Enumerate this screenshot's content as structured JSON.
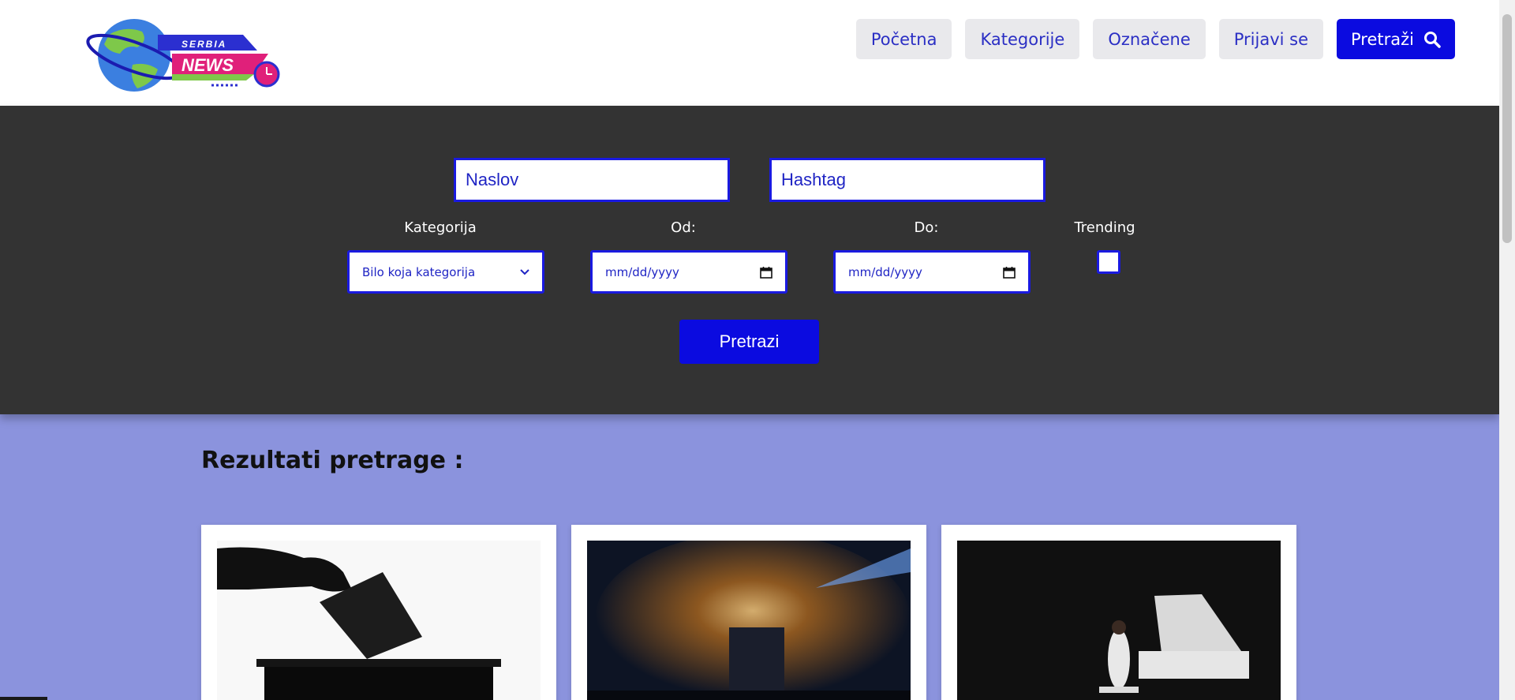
{
  "brand": {
    "top": "SERBIA",
    "main": "NEWS"
  },
  "nav": {
    "items": [
      "Početna",
      "Kategorije",
      "Označene",
      "Prijavi se"
    ],
    "search_label": "Pretraži"
  },
  "search_form": {
    "title_placeholder": "Naslov",
    "hashtag_placeholder": "Hashtag",
    "category_label": "Kategorija",
    "category_value": "Bilo koja kategorija",
    "from_label": "Od:",
    "from_value": "mm/dd/yyyy",
    "to_label": "Do:",
    "to_value": "mm/dd/yyyy",
    "trending_label": "Trending",
    "submit_label": "Pretrazi"
  },
  "results": {
    "title": "Rezultati pretrage :"
  },
  "colors": {
    "accent": "#0b0be0",
    "panel": "#333333",
    "page_bg": "#8b93dd"
  }
}
